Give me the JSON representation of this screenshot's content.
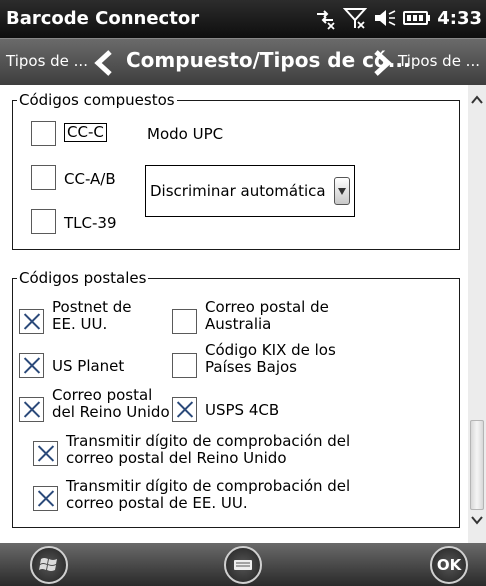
{
  "statusbar": {
    "title": "Barcode Connector",
    "time": "4:33",
    "icons": [
      "sync-icon",
      "signal-off-icon",
      "volume-muted-icon",
      "battery-icon"
    ]
  },
  "navbar": {
    "prev_label": "Tipos de ...",
    "title": "Compuesto/Tipos de có...",
    "next_label": "Tipos de ..."
  },
  "composite": {
    "legend": "Códigos compuestos",
    "items": [
      {
        "label": "CC-C",
        "checked": false,
        "focused": true
      },
      {
        "label": "CC-A/B",
        "checked": false
      },
      {
        "label": "TLC-39",
        "checked": false
      }
    ],
    "upc_mode_label": "Modo UPC",
    "upc_mode_value": "Discriminar automáticame"
  },
  "postal": {
    "legend": "Códigos postales",
    "items": [
      {
        "label_line1": "Postnet de",
        "label_line2": "EE. UU.",
        "checked": true
      },
      {
        "label_line1": "Correo postal de",
        "label_line2": "Australia",
        "checked": false
      },
      {
        "label_line1": "US Planet",
        "label_line2": "",
        "checked": true
      },
      {
        "label_line1": "Código KIX de los",
        "label_line2": "Países Bajos",
        "checked": false
      },
      {
        "label_line1": "Correo postal",
        "label_line2": "del Reino Unido",
        "checked": true
      },
      {
        "label_line1": "USPS 4CB",
        "label_line2": "",
        "checked": true
      },
      {
        "label_line1": "Transmitir dígito de comprobación del",
        "label_line2": "correo postal del Reino Unido",
        "checked": true
      },
      {
        "label_line1": "Transmitir dígito de comprobación del",
        "label_line2": "correo postal de EE. UU.",
        "checked": true
      }
    ]
  },
  "bottombar": {
    "ok_label": "OK"
  }
}
